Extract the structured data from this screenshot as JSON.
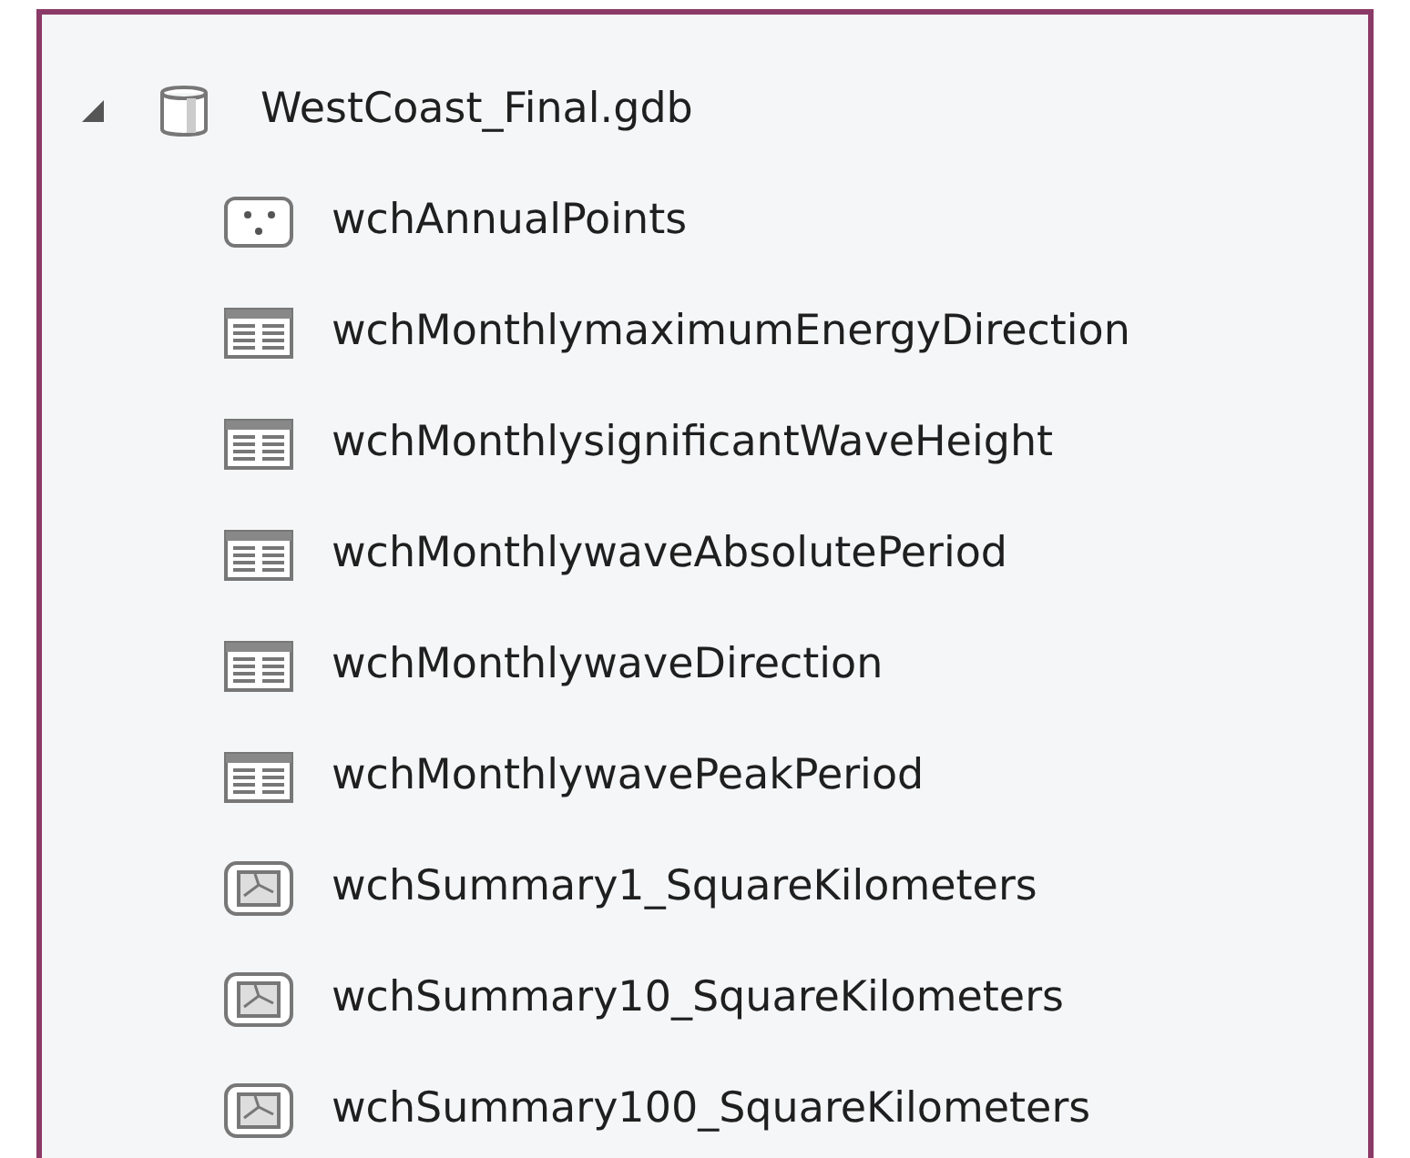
{
  "tree": [
    {
      "label": "WestCoast_Final.gdb",
      "kind": "database",
      "expanded": true,
      "children": [
        {
          "label": "wchAnnualPoints",
          "kind": "points"
        },
        {
          "label": "wchMonthlymaximumEnergyDirection",
          "kind": "table"
        },
        {
          "label": "wchMonthlysignificantWaveHeight",
          "kind": "table"
        },
        {
          "label": "wchMonthlywaveAbsolutePeriod",
          "kind": "table"
        },
        {
          "label": "wchMonthlywaveDirection",
          "kind": "table"
        },
        {
          "label": "wchMonthlywavePeakPeriod",
          "kind": "table"
        },
        {
          "label": "wchSummary1_SquareKilometers",
          "kind": "raster"
        },
        {
          "label": "wchSummary10_SquareKilometers",
          "kind": "raster"
        },
        {
          "label": "wchSummary100_SquareKilometers",
          "kind": "raster"
        }
      ]
    }
  ]
}
